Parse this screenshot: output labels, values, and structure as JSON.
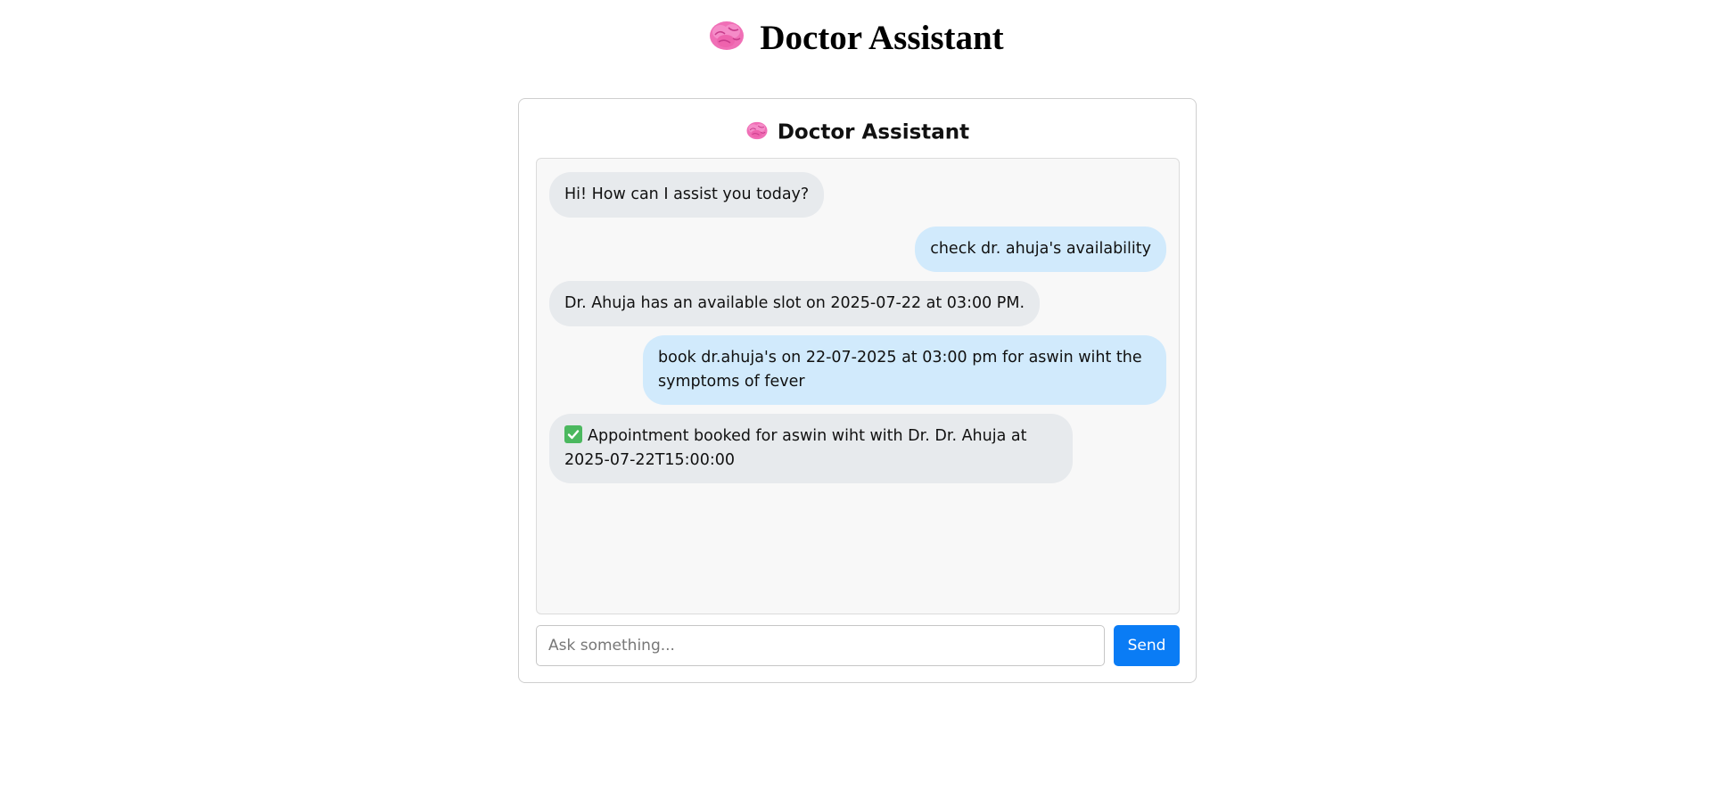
{
  "page": {
    "header_title": "Doctor Assistant",
    "header_icon": "brain-icon"
  },
  "chat": {
    "title": "Doctor Assistant",
    "title_icon": "brain-icon",
    "messages": [
      {
        "role": "bot",
        "text": "Hi! How can I assist you today?"
      },
      {
        "role": "user",
        "text": "check dr. ahuja's availability"
      },
      {
        "role": "bot",
        "text": "Dr. Ahuja has an available slot on 2025-07-22 at 03:00 PM."
      },
      {
        "role": "user",
        "text": "book dr.ahuja's on 22-07-2025 at 03:00 pm for aswin wiht the symptoms of fever"
      },
      {
        "role": "bot",
        "icon": "check-mark-icon",
        "text": "Appointment booked for aswin wiht with Dr. Dr. Ahuja at 2025-07-22T15:00:00"
      }
    ]
  },
  "input": {
    "placeholder": "Ask something...",
    "value": ""
  },
  "send_button": {
    "label": "Send"
  },
  "colors": {
    "bot_bubble": "#e7eaed",
    "user_bubble": "#d1eafc",
    "send_button": "#0a7cf5",
    "check_icon": "#4bb85f"
  }
}
